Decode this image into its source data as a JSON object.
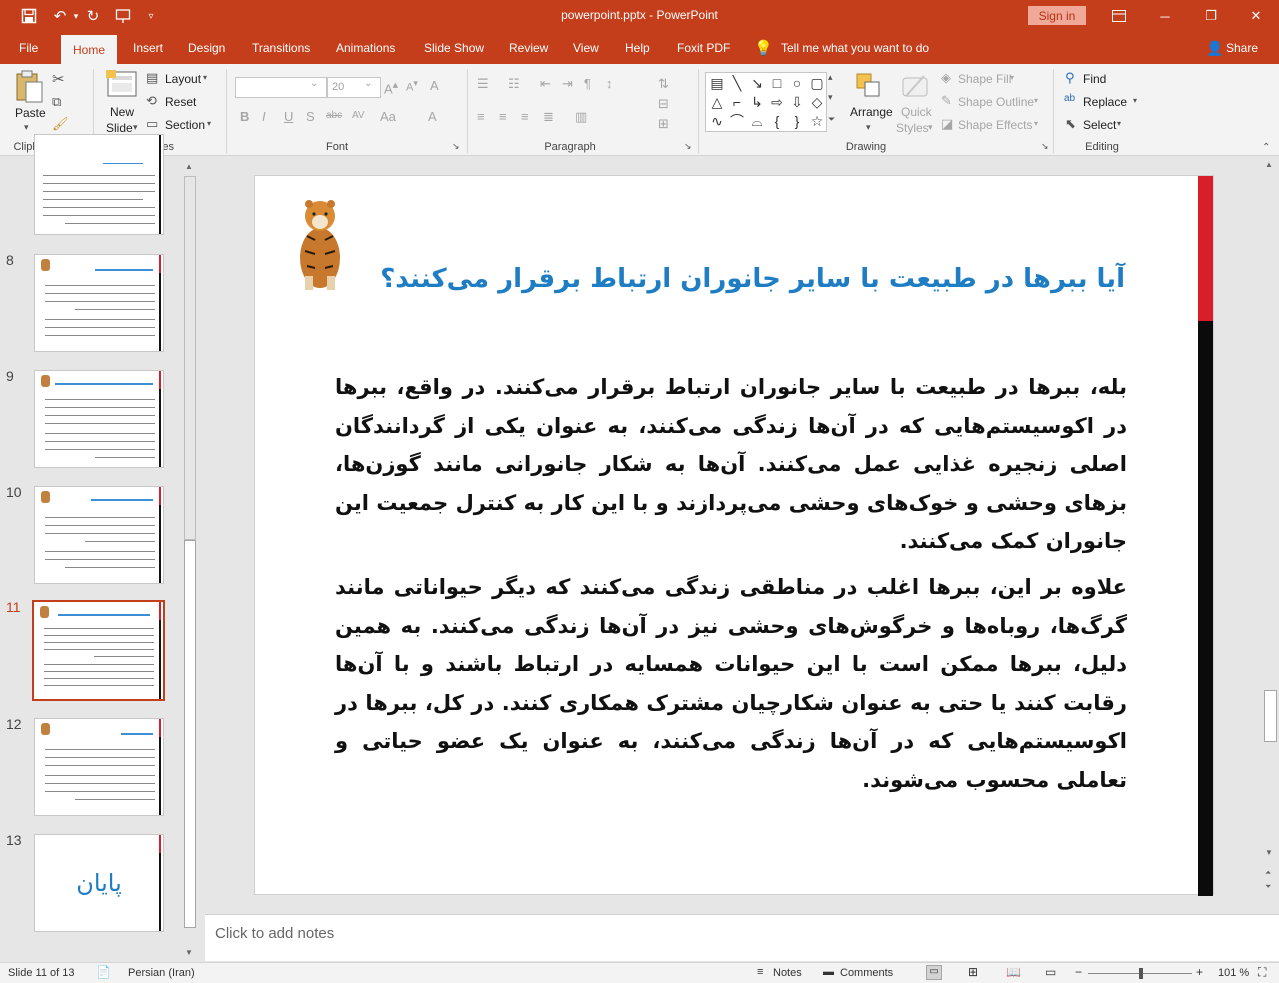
{
  "titlebar": {
    "title": "powerpoint.pptx  -  PowerPoint",
    "signin": "Sign in"
  },
  "tabs": [
    "File",
    "Home",
    "Insert",
    "Design",
    "Transitions",
    "Animations",
    "Slide Show",
    "Review",
    "View",
    "Help",
    "Foxit PDF"
  ],
  "tell_me": "Tell me what you want to do",
  "share": "Share",
  "ribbon": {
    "clipboard": {
      "paste": "Paste",
      "label": "Clipboard"
    },
    "slides": {
      "new_slide_1": "New",
      "new_slide_2": "Slide",
      "layout": "Layout",
      "reset": "Reset",
      "section": "Section",
      "label": "Slides"
    },
    "font": {
      "size": "20",
      "label": "Font"
    },
    "paragraph": {
      "label": "Paragraph"
    },
    "drawing": {
      "arrange": "Arrange",
      "quick_styles_1": "Quick",
      "quick_styles_2": "Styles",
      "shape_fill": "Shape Fill",
      "shape_outline": "Shape Outline",
      "shape_effects": "Shape Effects",
      "label": "Drawing"
    },
    "editing": {
      "find": "Find",
      "replace": "Replace",
      "select": "Select",
      "label": "Editing"
    }
  },
  "thumbnails": [
    {
      "num": "8"
    },
    {
      "num": "9"
    },
    {
      "num": "10"
    },
    {
      "num": "11"
    },
    {
      "num": "12"
    },
    {
      "num": "13",
      "text": "پایان"
    }
  ],
  "slide": {
    "title": "آیا ببرها در طبیعت با سایر جانوران ارتباط برقرار می‌کنند؟",
    "para1": "بله، ببرها در طبیعت با سایر جانوران ارتباط برقرار می‌کنند. در واقع، ببرها در اکوسیستم‌هایی که در آن‌ها زندگی می‌کنند، به عنوان یکی از گردانندگان اصلی زنجیره غذایی عمل می‌کنند. آن‌ها به شکار جانورانی مانند گوزن‌ها، بزهای وحشی و خوک‌های وحشی می‌پردازند و با این کار به کنترل جمعیت این جانوران کمک می‌کنند.",
    "para2": "علاوه بر این، ببرها اغلب در مناطقی زندگی می‌کنند که دیگر حیواناتی مانند گرگ‌ها، روباه‌ها و خرگوش‌های وحشی نیز در آن‌ها زندگی می‌کنند. به همین دلیل، ببرها ممکن است با این حیوانات همسایه در ارتباط باشند و با آن‌ها رقابت کنند یا حتی به عنوان شکارچیان مشترک همکاری کنند. در کل، ببرها در اکوسیستم‌هایی که در آن‌ها زندگی می‌کنند، به عنوان یک عضو حیاتی و تعاملی محسوب می‌شوند."
  },
  "notes_placeholder": "Click to add notes",
  "status": {
    "slide_info": "Slide 11 of 13",
    "language": "Persian (Iran)",
    "notes": "Notes",
    "comments": "Comments",
    "zoom": "101 %"
  },
  "colors": {
    "accent": "#c43e1c",
    "title_blue": "#1e7dc3",
    "slide_red": "#d81e2a"
  }
}
